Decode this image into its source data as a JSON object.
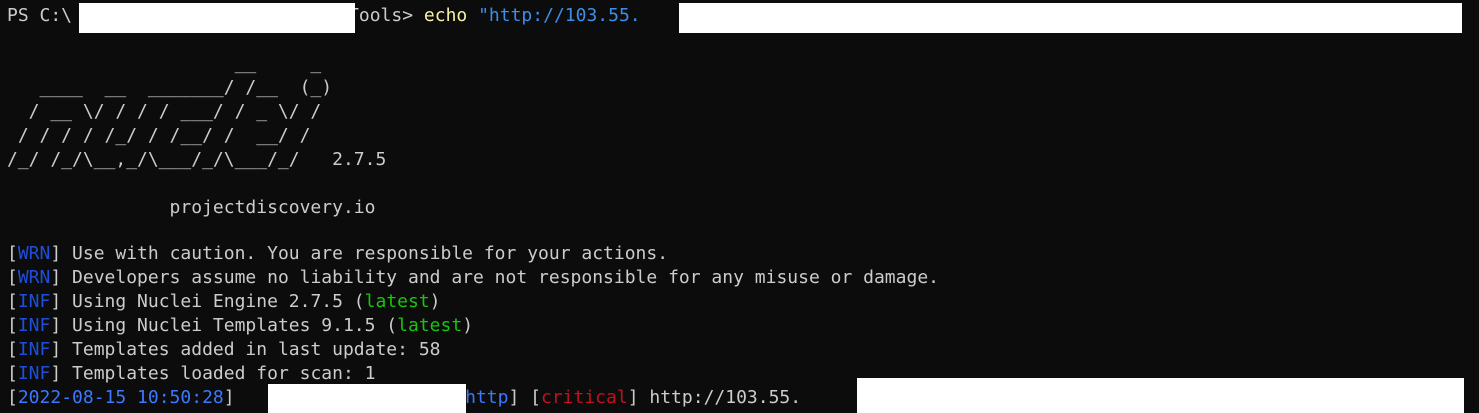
{
  "colors": {
    "background": "#0c0c0c",
    "foreground": "#cccccc",
    "command_yellow": "#f9f1a5",
    "string_blue": "#3b8eea",
    "tag_blue": "#1f4fd8",
    "latest_green": "#16c60c",
    "critical_red": "#c50f1f",
    "redaction": "#ffffff"
  },
  "prompt": {
    "prefix": "PS C:\\",
    "suffix": "Tools> ",
    "command": "echo",
    "arg": " \"http://103.55."
  },
  "banner": {
    "ascii_lines": [
      "                     __     _",
      "   ____  __  _______/ /__  (_)",
      "  / __ \\/ / / / ___/ / _ \\/ /",
      " / / / / /_/ / /__/ /  __/ /",
      "/_/ /_/\\__,_/\\___/_/\\___/_/"
    ],
    "version": "   2.7.5",
    "site": "               projectdiscovery.io"
  },
  "log_lines": [
    {
      "tag": "WRN",
      "text": " Use with caution. You are responsible for your actions.",
      "extra": "",
      "tail": ""
    },
    {
      "tag": "WRN",
      "text": " Developers assume no liability and are not responsible for any misuse or damage.",
      "extra": "",
      "tail": ""
    },
    {
      "tag": "INF",
      "text": " Using Nuclei Engine 2.7.5 (",
      "extra": "latest",
      "tail": ")"
    },
    {
      "tag": "INF",
      "text": " Using Nuclei Templates 9.1.5 (",
      "extra": "latest",
      "tail": ")"
    },
    {
      "tag": "INF",
      "text": " Templates added in last update: 58",
      "extra": "",
      "tail": ""
    },
    {
      "tag": "INF",
      "text": " Templates loaded for scan: 1",
      "extra": "",
      "tail": ""
    }
  ],
  "result": {
    "timestamp": "2022-08-15 10:50:28",
    "protocol": "http",
    "severity": "critical",
    "url": " http://103.55."
  }
}
